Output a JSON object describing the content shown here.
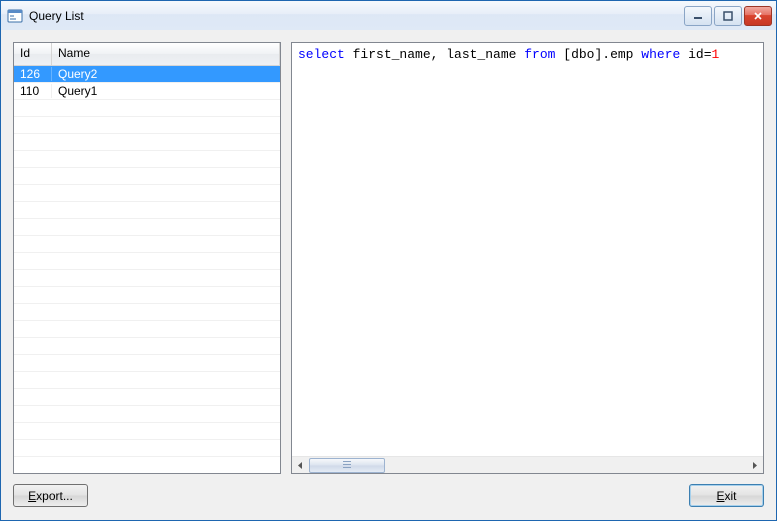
{
  "window": {
    "title": "Query List"
  },
  "grid": {
    "headers": {
      "id": "Id",
      "name": "Name"
    },
    "rows": [
      {
        "id": "126",
        "name": "Query2",
        "selected": true
      },
      {
        "id": "110",
        "name": "Query1",
        "selected": false
      }
    ],
    "empty_row_count": 22
  },
  "sql": {
    "tokens": [
      {
        "t": "select",
        "c": "kw"
      },
      {
        "t": " first_name, last_name ",
        "c": ""
      },
      {
        "t": "from",
        "c": "kw"
      },
      {
        "t": " [dbo].emp ",
        "c": ""
      },
      {
        "t": "where",
        "c": "kw"
      },
      {
        "t": " id=",
        "c": ""
      },
      {
        "t": "1",
        "c": "num"
      }
    ]
  },
  "buttons": {
    "export": "Export...",
    "exit": "Exit"
  }
}
